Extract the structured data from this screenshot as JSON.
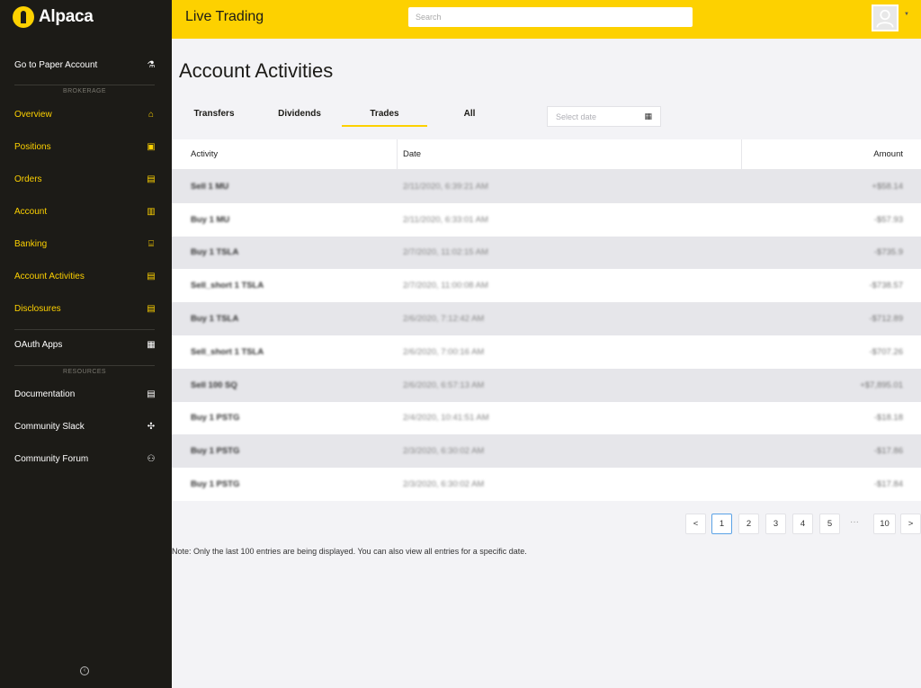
{
  "brand": {
    "name": "Alpaca",
    "accent": "#fdd100",
    "sidebar_bg": "#1c1b17"
  },
  "header": {
    "title": "Live Trading",
    "search_placeholder": "Search"
  },
  "sidebar": {
    "paper": {
      "label": "Go to Paper Account",
      "icon": "⚗"
    },
    "brokerage_label": "BROKERAGE",
    "brokerage": [
      {
        "label": "Overview",
        "icon": "⌂"
      },
      {
        "label": "Positions",
        "icon": "▣"
      },
      {
        "label": "Orders",
        "icon": "▤"
      },
      {
        "label": "Account",
        "icon": "▥"
      },
      {
        "label": "Banking",
        "icon": "⌸"
      },
      {
        "label": "Account Activities",
        "icon": "▤"
      },
      {
        "label": "Disclosures",
        "icon": "▤"
      }
    ],
    "oauth": {
      "label": "OAuth Apps",
      "icon": "▦"
    },
    "resources_label": "RESOURCES",
    "resources": [
      {
        "label": "Documentation",
        "icon": "▤"
      },
      {
        "label": "Community Slack",
        "icon": "✣"
      },
      {
        "label": "Community Forum",
        "icon": "⚇"
      }
    ]
  },
  "main": {
    "title": "Account Activities",
    "tabs": [
      "Transfers",
      "Dividends",
      "Trades",
      "All"
    ],
    "active_tab": "Trades",
    "date_placeholder": "Select date",
    "table": {
      "headers": [
        "Activity",
        "Date",
        "Amount"
      ],
      "rows": [
        [
          "Sell 1 MU",
          "2/11/2020, 6:39:21 AM",
          "+$58.14"
        ],
        [
          "Buy 1 MU",
          "2/11/2020, 6:33:01 AM",
          "-$57.93"
        ],
        [
          "Buy 1 TSLA",
          "2/7/2020, 11:02:15 AM",
          "-$735.9"
        ],
        [
          "Sell_short 1 TSLA",
          "2/7/2020, 11:00:08 AM",
          "-$738.57"
        ],
        [
          "Buy 1 TSLA",
          "2/6/2020, 7:12:42 AM",
          "-$712.89"
        ],
        [
          "Sell_short 1 TSLA",
          "2/6/2020, 7:00:16 AM",
          "-$707.26"
        ],
        [
          "Sell 100 SQ",
          "2/6/2020, 6:57:13 AM",
          "+$7,895.01"
        ],
        [
          "Buy 1 PSTG",
          "2/4/2020, 10:41:51 AM",
          "-$18.18"
        ],
        [
          "Buy 1 PSTG",
          "2/3/2020, 6:30:02 AM",
          "-$17.86"
        ],
        [
          "Buy 1 PSTG",
          "2/3/2020, 6:30:02 AM",
          "-$17.84"
        ]
      ]
    },
    "pagination": {
      "prev": "<",
      "pages": [
        "1",
        "2",
        "3",
        "4",
        "5"
      ],
      "ellipsis": "···",
      "last": "10",
      "next": ">",
      "current": "1"
    },
    "note": "Note: Only the last 100 entries are being displayed. You can also view all entries for a specific date."
  }
}
